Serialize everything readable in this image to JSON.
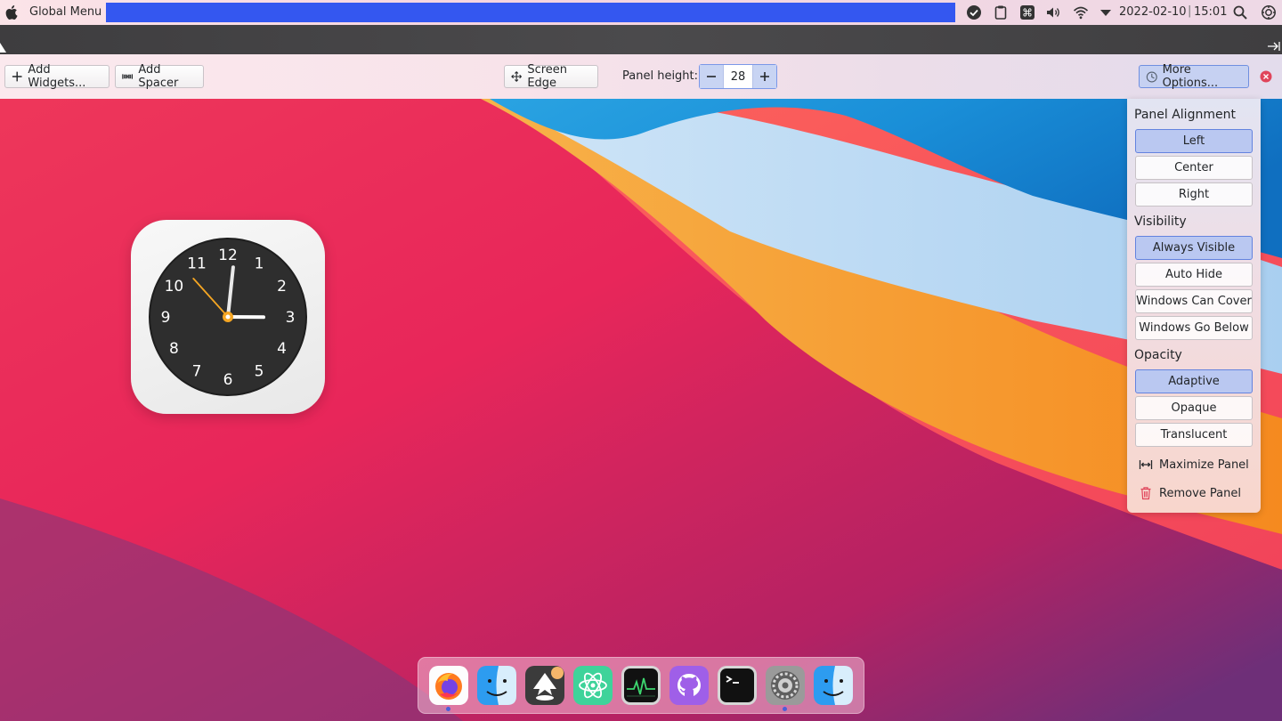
{
  "menubar": {
    "app_menu": "Global Menu",
    "datetime": "2022-02-10",
    "time": "15:01",
    "tray_icons": [
      "check-circle-icon",
      "clipboard-icon",
      "command-key-icon",
      "volume-icon",
      "wifi-icon",
      "tray-expand-icon",
      "search-icon",
      "settings-icon"
    ],
    "highlight_color": "#3457f0"
  },
  "toolbar": {
    "add_widgets": "Add Widgets...",
    "add_spacer": "Add Spacer",
    "screen_edge": "Screen Edge",
    "panel_height_label": "Panel height:",
    "panel_height_value": "28",
    "more_options": "More Options..."
  },
  "options_popup": {
    "alignment": {
      "title": "Panel Alignment",
      "options": [
        "Left",
        "Center",
        "Right"
      ],
      "selected": "Left"
    },
    "visibility": {
      "title": "Visibility",
      "options": [
        "Always Visible",
        "Auto Hide",
        "Windows Can Cover",
        "Windows Go Below"
      ],
      "selected": "Always Visible"
    },
    "opacity": {
      "title": "Opacity",
      "options": [
        "Adaptive",
        "Opaque",
        "Translucent"
      ],
      "selected": "Adaptive"
    },
    "actions": {
      "maximize": "Maximize Panel",
      "remove": "Remove Panel"
    }
  },
  "clock_widget": {
    "numerals": [
      "12",
      "1",
      "2",
      "3",
      "4",
      "5",
      "6",
      "7",
      "8",
      "9",
      "10",
      "11"
    ],
    "time_shown": "15:01"
  },
  "dock": {
    "apps": [
      "firefox",
      "finder",
      "inkscape",
      "atom",
      "activity-monitor",
      "github-desktop",
      "terminal",
      "system-preferences",
      "finder"
    ],
    "running": [
      "firefox",
      "system-preferences"
    ],
    "indicator_color": "#4b5fd8"
  },
  "colors": {
    "selected_button": "#bac8f1",
    "selected_border": "#6383df",
    "remove_red": "#e0445a"
  }
}
